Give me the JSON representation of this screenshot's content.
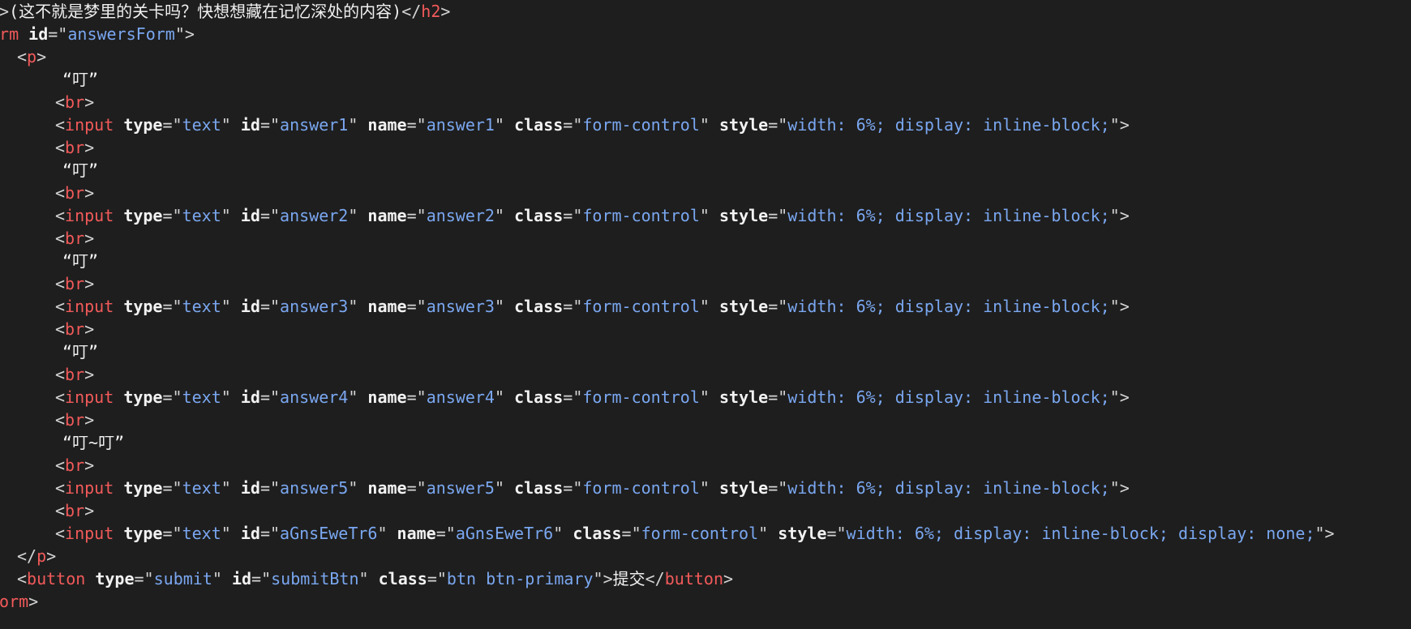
{
  "theme": {
    "background": "#1e1e1e",
    "tag_color": "#f35a5a",
    "attr_color": "#f2f2f2",
    "value_color": "#7aa7f0",
    "text_color": "#f0f0f0"
  },
  "h2": {
    "open_tag_tail": "2",
    "text": "(这不就是梦里的关卡吗？快想想藏在记忆深处的内容)",
    "close_tag": "h2"
  },
  "form": {
    "open_tag_tail": "orm",
    "id_attr": "id",
    "id_value": "answersForm",
    "close_tag_tail": "form"
  },
  "p_tag": "p",
  "br_tag": "br",
  "input_tag": "input",
  "attrs": {
    "type": "type",
    "id": "id",
    "name": "name",
    "class": "class",
    "style": "style"
  },
  "questions": [
    {
      "prompt": "“叮”",
      "type": "text",
      "id": "answer1",
      "name": "answer1",
      "class": "form-control",
      "style": "width: 6%; display: inline-block;"
    },
    {
      "prompt": "“叮”",
      "type": "text",
      "id": "answer2",
      "name": "answer2",
      "class": "form-control",
      "style": "width: 6%; display: inline-block;"
    },
    {
      "prompt": "“叮”",
      "type": "text",
      "id": "answer3",
      "name": "answer3",
      "class": "form-control",
      "style": "width: 6%; display: inline-block;"
    },
    {
      "prompt": "“叮”",
      "type": "text",
      "id": "answer4",
      "name": "answer4",
      "class": "form-control",
      "style": "width: 6%; display: inline-block;"
    },
    {
      "prompt": "“叮~叮”",
      "type": "text",
      "id": "answer5",
      "name": "answer5",
      "class": "form-control",
      "style": "width: 6%; display: inline-block;"
    }
  ],
  "hidden_input": {
    "type": "text",
    "id": "aGnsEweTr6",
    "name": "aGnsEweTr6",
    "class": "form-control",
    "style": "width: 6%; display: inline-block; display: none;"
  },
  "button": {
    "tag": "button",
    "type": "submit",
    "id": "submitBtn",
    "class": "btn btn-primary",
    "label": "提交"
  }
}
